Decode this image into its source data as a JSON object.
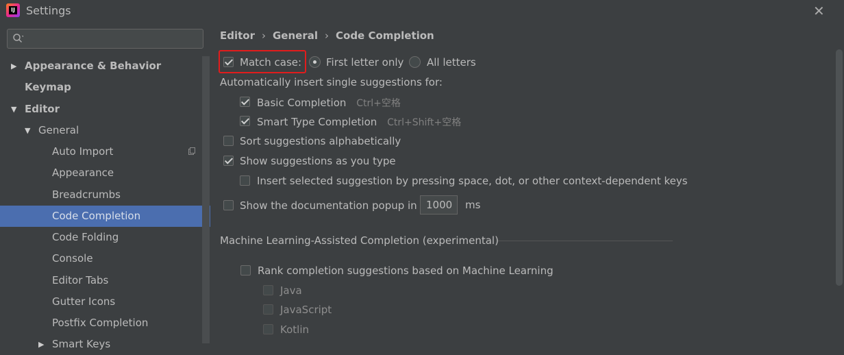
{
  "window": {
    "title": "Settings",
    "logo_text": "IJ"
  },
  "search": {
    "placeholder": ""
  },
  "sidebar": {
    "items": [
      {
        "label": "Appearance & Behavior",
        "arrow": "▶"
      },
      {
        "label": "Keymap"
      },
      {
        "label": "Editor",
        "arrow": "▼"
      },
      {
        "label": "General",
        "arrow": "▼"
      },
      {
        "label": "Auto Import"
      },
      {
        "label": "Appearance"
      },
      {
        "label": "Breadcrumbs"
      },
      {
        "label": "Code Completion"
      },
      {
        "label": "Code Folding"
      },
      {
        "label": "Console"
      },
      {
        "label": "Editor Tabs"
      },
      {
        "label": "Gutter Icons"
      },
      {
        "label": "Postfix Completion"
      },
      {
        "label": "Smart Keys",
        "arrow": "▶"
      }
    ]
  },
  "breadcrumb": {
    "parts": [
      "Editor",
      "General",
      "Code Completion"
    ],
    "separator": "›"
  },
  "options": {
    "match_case": "Match case:",
    "first_letter_only": "First letter only",
    "all_letters": "All letters",
    "auto_insert_heading": "Automatically insert single suggestions for:",
    "basic_completion": "Basic Completion",
    "basic_completion_shortcut": "Ctrl+空格",
    "smart_type_completion": "Smart Type Completion",
    "smart_type_completion_shortcut": "Ctrl+Shift+空格",
    "sort_alpha": "Sort suggestions alphabetically",
    "show_as_you_type": "Show suggestions as you type",
    "insert_selected": "Insert selected suggestion by pressing space, dot, or other context-dependent keys",
    "show_doc_popup": "Show the documentation popup in",
    "doc_popup_delay": "1000",
    "doc_popup_unit": "ms",
    "ml_section": "Machine Learning-Assisted Completion (experimental)",
    "ml_rank": "Rank completion suggestions based on Machine Learning",
    "ml_java": "Java",
    "ml_javascript": "JavaScript",
    "ml_kotlin": "Kotlin"
  },
  "state": {
    "match_case": true,
    "case_mode": "First letter only",
    "basic_completion": true,
    "smart_type_completion": true,
    "sort_alpha": false,
    "show_as_you_type": true,
    "insert_selected": false,
    "show_doc_popup": false,
    "ml_rank": false,
    "ml_java": false,
    "ml_javascript": false,
    "ml_kotlin": false
  },
  "colors": {
    "highlight_box": "#e21c1c",
    "selection": "#4b6eaf"
  }
}
